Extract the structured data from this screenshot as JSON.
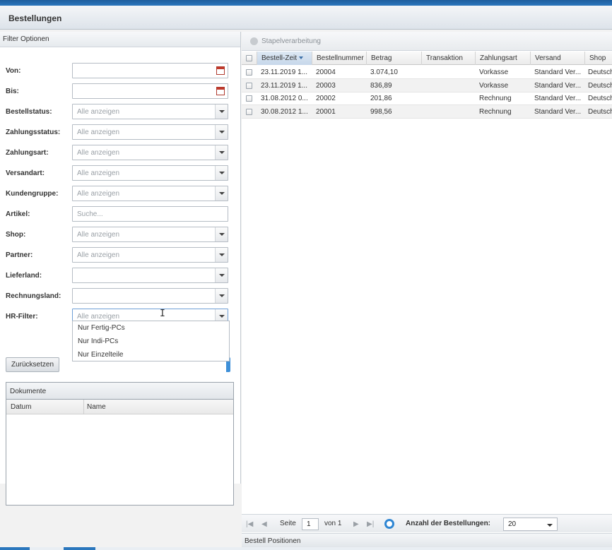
{
  "window": {
    "title": "Bestellungen"
  },
  "filter": {
    "header": "Filter Optionen",
    "fields": [
      {
        "label": "Von:",
        "value": "",
        "type": "date"
      },
      {
        "label": "Bis:",
        "value": "",
        "type": "date"
      },
      {
        "label": "Bestellstatus:",
        "value": "Alle anzeigen",
        "type": "select"
      },
      {
        "label": "Zahlungsstatus:",
        "value": "Alle anzeigen",
        "type": "select"
      },
      {
        "label": "Zahlungsart:",
        "value": "Alle anzeigen",
        "type": "select"
      },
      {
        "label": "Versandart:",
        "value": "Alle anzeigen",
        "type": "select"
      },
      {
        "label": "Kundengruppe:",
        "value": "Alle anzeigen",
        "type": "select"
      },
      {
        "label": "Artikel:",
        "placeholder": "Suche...",
        "type": "text"
      },
      {
        "label": "Shop:",
        "value": "Alle anzeigen",
        "type": "select"
      },
      {
        "label": "Partner:",
        "value": "Alle anzeigen",
        "type": "select"
      },
      {
        "label": "Lieferland:",
        "value": "",
        "type": "select"
      },
      {
        "label": "Rechnungsland:",
        "value": "",
        "type": "select"
      },
      {
        "label": "HR-Filter:",
        "value": "Alle anzeigen",
        "type": "select"
      }
    ],
    "hr_dropdown_options": [
      "Nur Fertig-PCs",
      "Nur Indi-PCs",
      "Nur Einzelteile"
    ],
    "reset_label": "Zurücksetzen"
  },
  "documents": {
    "title": "Dokumente",
    "columns": [
      "Datum",
      "Name"
    ]
  },
  "orders": {
    "toolbar_label": "Stapelverarbeitung",
    "columns": [
      "Bestell-Zeit",
      "Bestellnummer",
      "Betrag",
      "Transaktion",
      "Zahlungsart",
      "Versand",
      "Shop"
    ],
    "rows": [
      {
        "zeit": "23.11.2019 1...",
        "nummer": "20004",
        "betrag": "3.074,10",
        "transaktion": "",
        "zahlungsart": "Vorkasse",
        "versand": "Standard Ver...",
        "shop": "Deutsch"
      },
      {
        "zeit": "23.11.2019 1...",
        "nummer": "20003",
        "betrag": "836,89",
        "transaktion": "",
        "zahlungsart": "Vorkasse",
        "versand": "Standard Ver...",
        "shop": "Deutsch"
      },
      {
        "zeit": "31.08.2012 0...",
        "nummer": "20002",
        "betrag": "201,86",
        "transaktion": "",
        "zahlungsart": "Rechnung",
        "versand": "Standard Ver...",
        "shop": "Deutsch"
      },
      {
        "zeit": "30.08.2012 1...",
        "nummer": "20001",
        "betrag": "998,56",
        "transaktion": "",
        "zahlungsart": "Rechnung",
        "versand": "Standard Ver...",
        "shop": "Deutsch"
      }
    ]
  },
  "pager": {
    "page_label": "Seite",
    "page_value": "1",
    "of_label": "von 1",
    "count_label": "Anzahl der Bestellungen:",
    "count_value": "20"
  },
  "positions": {
    "title": "Bestell Positionen"
  }
}
